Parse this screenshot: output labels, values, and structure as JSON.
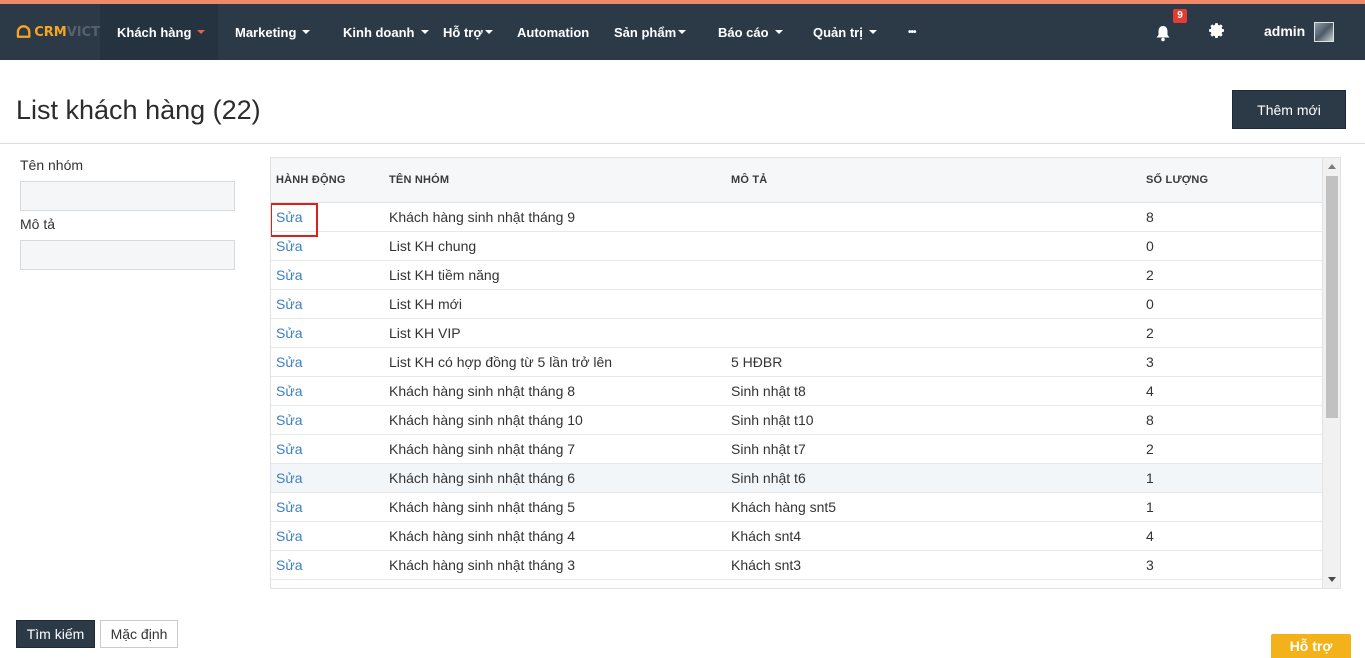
{
  "nav": {
    "logo_part1": "CRM",
    "logo_part2": "VICT",
    "items": [
      {
        "label": "Khách hàng",
        "has_caret": true,
        "active": true
      },
      {
        "label": "Marketing",
        "has_caret": true
      },
      {
        "label": "Kinh doanh",
        "has_caret": true
      },
      {
        "label": "Hỗ trợ",
        "has_caret": true
      },
      {
        "label": "Automation",
        "has_caret": false
      },
      {
        "label": "Sản phẩm",
        "has_caret": true
      },
      {
        "label": "Báo cáo",
        "has_caret": true
      },
      {
        "label": "Quản trị",
        "has_caret": true
      },
      {
        "label": "•••",
        "has_caret": false
      }
    ],
    "notification_count": "9",
    "user_name": "admin"
  },
  "header": {
    "title": "List khách hàng (22)",
    "add_button": "Thêm mới"
  },
  "filter": {
    "group_name_label": "Tên nhóm",
    "group_name_value": "",
    "description_label": "Mô tả",
    "description_value": ""
  },
  "table": {
    "columns": [
      "HÀNH ĐỘNG",
      "TÊN NHÓM",
      "MÔ TẢ",
      "SỐ LƯỢNG"
    ],
    "rows": [
      {
        "action": "Sửa",
        "name": "Khách hàng sinh nhật tháng 9",
        "desc": "",
        "qty": "8"
      },
      {
        "action": "Sửa",
        "name": "List KH chung",
        "desc": "",
        "qty": "0"
      },
      {
        "action": "Sửa",
        "name": "List KH tiềm năng",
        "desc": "",
        "qty": "2"
      },
      {
        "action": "Sửa",
        "name": "List KH mới",
        "desc": "",
        "qty": "0"
      },
      {
        "action": "Sửa",
        "name": "List KH VIP",
        "desc": "",
        "qty": "2"
      },
      {
        "action": "Sửa",
        "name": "List KH có hợp đồng từ 5 lần trở lên",
        "desc": "5 HĐBR",
        "qty": "3"
      },
      {
        "action": "Sửa",
        "name": "Khách hàng sinh nhật tháng 8",
        "desc": "Sinh nhật t8",
        "qty": "4"
      },
      {
        "action": "Sửa",
        "name": "Khách hàng sinh nhật tháng 10",
        "desc": "Sinh nhật t10",
        "qty": "8"
      },
      {
        "action": "Sửa",
        "name": "Khách hàng sinh nhật tháng 7",
        "desc": "Sinh nhật t7",
        "qty": "2"
      },
      {
        "action": "Sửa",
        "name": "Khách hàng sinh nhật tháng 6",
        "desc": "Sinh nhật t6",
        "qty": "1"
      },
      {
        "action": "Sửa",
        "name": "Khách hàng sinh nhật tháng 5",
        "desc": "Khách hàng snt5",
        "qty": "1"
      },
      {
        "action": "Sửa",
        "name": "Khách hàng sinh nhật tháng 4",
        "desc": "Khách snt4",
        "qty": "4"
      },
      {
        "action": "Sửa",
        "name": "Khách hàng sinh nhật tháng 3",
        "desc": "Khách snt3",
        "qty": "3"
      }
    ],
    "highlighted_row": 9,
    "selected_action_row": 0
  },
  "buttons": {
    "search": "Tìm kiếm",
    "default": "Mặc định",
    "help": "Hỗ trợ"
  },
  "colors": {
    "nav_bg": "#2c3a48",
    "accent": "#f0896a",
    "link": "#3b7fc4",
    "help": "#f4b21a"
  }
}
